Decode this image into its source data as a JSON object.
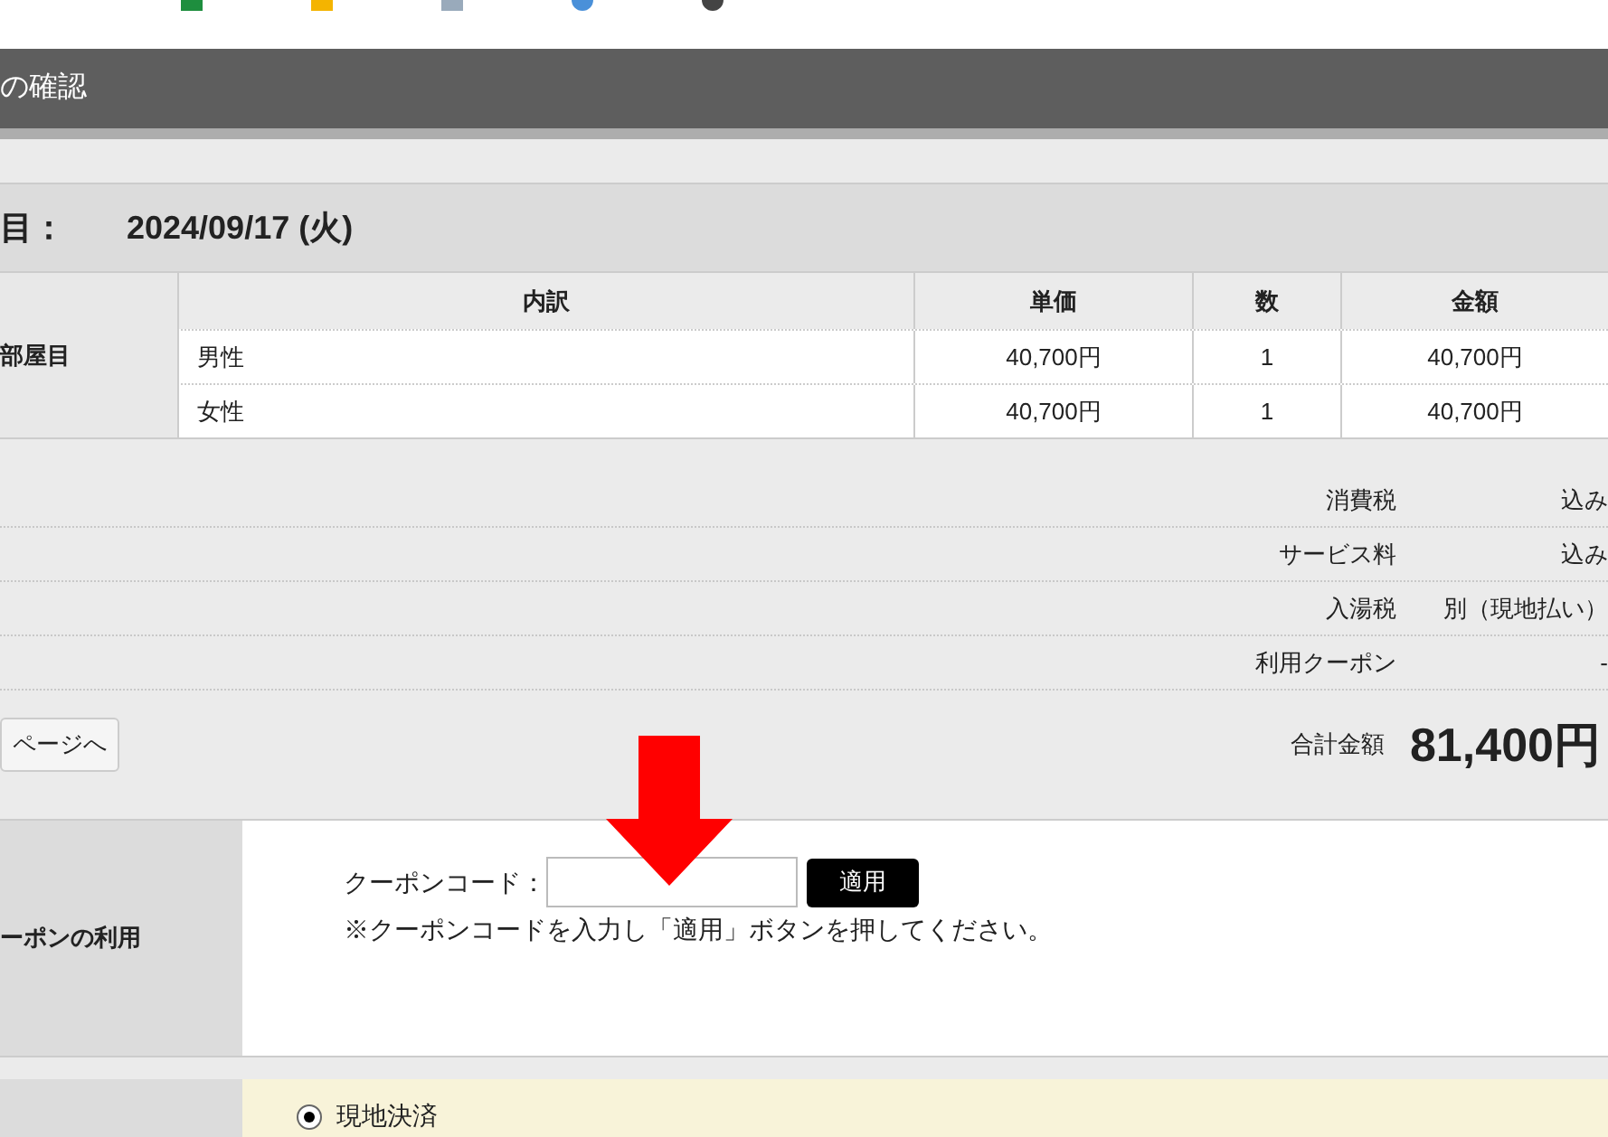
{
  "header": {
    "title": "の確認"
  },
  "date": {
    "label": "目：",
    "value": "2024/09/17 (火)"
  },
  "room": {
    "label": "部屋目",
    "columns": [
      "内訳",
      "単価",
      "数",
      "金額"
    ],
    "rows": [
      {
        "item": "男性",
        "price": "40,700円",
        "qty": "1",
        "amount": "40,700円"
      },
      {
        "item": "女性",
        "price": "40,700円",
        "qty": "1",
        "amount": "40,700円"
      }
    ]
  },
  "summary": [
    {
      "label": "消費税",
      "value": "込み"
    },
    {
      "label": "サービス料",
      "value": "込み"
    },
    {
      "label": "入湯税",
      "value": "別（現地払い）"
    },
    {
      "label": "利用クーポン",
      "value": "-"
    }
  ],
  "back_button": "ページへ",
  "total": {
    "label": "合計金額",
    "value": "81,400円"
  },
  "coupon": {
    "section_label": "ーポンの利用",
    "field_label": "クーポンコード：",
    "apply_button": "適用",
    "note": "※クーポンコードを入力し「適用」ボタンを押してください。"
  },
  "payment": {
    "options": [
      {
        "label": "現地決済",
        "selected": true
      }
    ]
  }
}
